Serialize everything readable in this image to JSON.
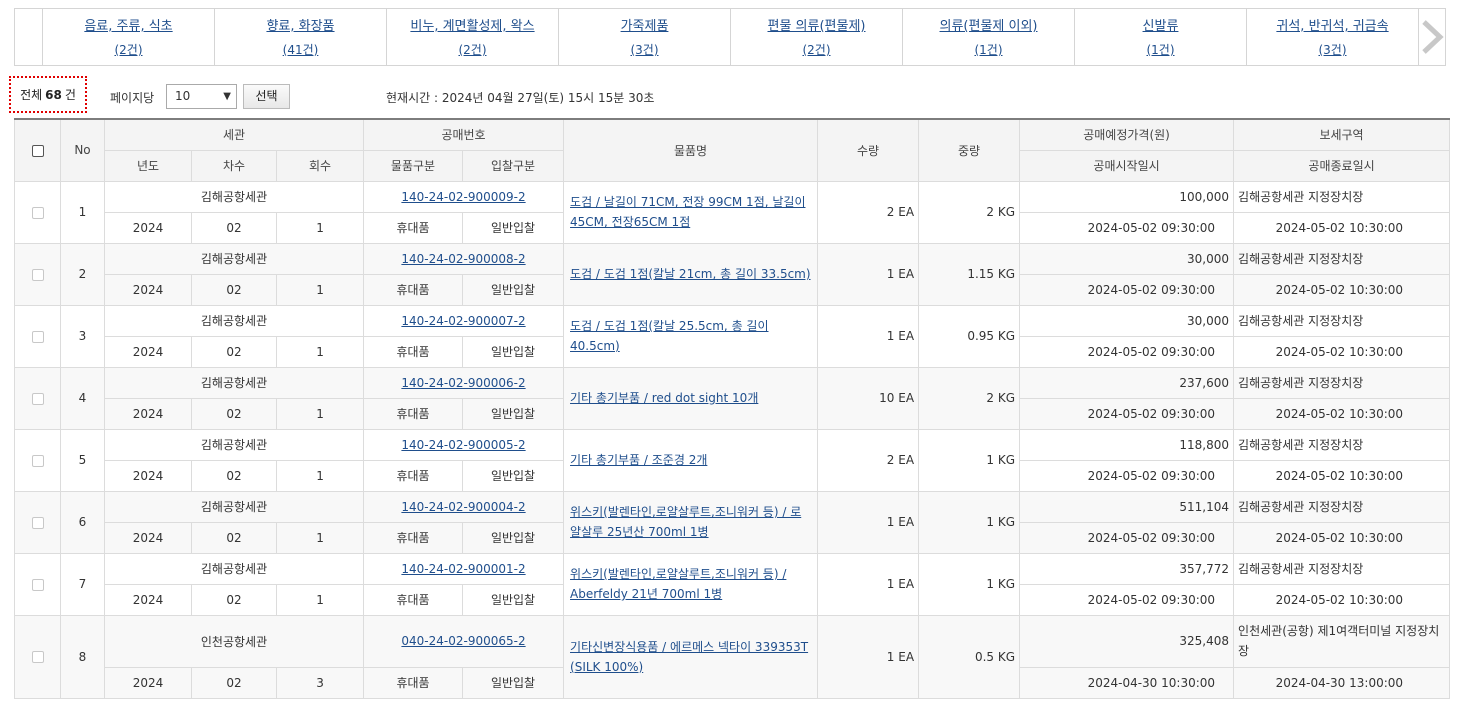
{
  "categories": [
    {
      "name": "음료, 주류, 식초",
      "count": "(2건)"
    },
    {
      "name": "향료, 화장품",
      "count": "(41건)"
    },
    {
      "name": "비누, 계면활성제, 왁스",
      "count": "(2건)"
    },
    {
      "name": "가죽제품",
      "count": "(3건)"
    },
    {
      "name": "편물 의류(편물제)",
      "count": "(2건)"
    },
    {
      "name": "의류(편물제 이외)",
      "count": "(1건)"
    },
    {
      "name": "신발류",
      "count": "(1건)"
    },
    {
      "name": "귀석, 반귀석, 귀금속",
      "count": "(3건)"
    }
  ],
  "icons": {
    "next": "chevron-right-icon",
    "dropdown": "triangle-down-icon"
  },
  "colors": {
    "link": "#1f4e8c",
    "highlight_border": "#e00000"
  },
  "toolbar": {
    "total_prefix": "전체",
    "total_count": "68",
    "total_suffix": "건",
    "per_page_label": "페이지당",
    "per_page_value": "10",
    "select_button": "선택",
    "current_time": "현재시간 : 2024년 04월 27일(토) 15시 15분 30초"
  },
  "table": {
    "headers": {
      "no": "No",
      "customs": "세관",
      "year": "년도",
      "session": "차수",
      "round": "회수",
      "auction_no": "공매번호",
      "item_type": "물품구분",
      "bid_type": "입찰구분",
      "item_name": "물품명",
      "quantity": "수량",
      "weight": "중량",
      "price": "공매예정가격(원)",
      "start_date": "공매시작일시",
      "bonded_area": "보세구역",
      "end_date": "공매종료일시"
    },
    "rows": [
      {
        "no": "1",
        "customs": "김해공항세관",
        "year": "2024",
        "session": "02",
        "round": "1",
        "auction_no": "140-24-02-900009-2",
        "item_type": "휴대품",
        "bid_type": "일반입찰",
        "item_name": "도검 / 날길이 71CM, 전장 99CM 1점, 날길이 45CM, 전장65CM 1점",
        "quantity": "2 EA",
        "weight": "2 KG",
        "price": "100,000",
        "start_date": "2024-05-02 09:30:00",
        "bonded_area": "김해공항세관 지정장치장",
        "end_date": "2024-05-02 10:30:00"
      },
      {
        "no": "2",
        "customs": "김해공항세관",
        "year": "2024",
        "session": "02",
        "round": "1",
        "auction_no": "140-24-02-900008-2",
        "item_type": "휴대품",
        "bid_type": "일반입찰",
        "item_name": "도검 / 도검 1점(칼날 21cm, 총 길이 33.5cm)",
        "quantity": "1 EA",
        "weight": "1.15 KG",
        "price": "30,000",
        "start_date": "2024-05-02 09:30:00",
        "bonded_area": "김해공항세관 지정장치장",
        "end_date": "2024-05-02 10:30:00"
      },
      {
        "no": "3",
        "customs": "김해공항세관",
        "year": "2024",
        "session": "02",
        "round": "1",
        "auction_no": "140-24-02-900007-2",
        "item_type": "휴대품",
        "bid_type": "일반입찰",
        "item_name": "도검 / 도검 1점(칼날 25.5cm, 총 길이 40.5cm)",
        "quantity": "1 EA",
        "weight": "0.95 KG",
        "price": "30,000",
        "start_date": "2024-05-02 09:30:00",
        "bonded_area": "김해공항세관 지정장치장",
        "end_date": "2024-05-02 10:30:00"
      },
      {
        "no": "4",
        "customs": "김해공항세관",
        "year": "2024",
        "session": "02",
        "round": "1",
        "auction_no": "140-24-02-900006-2",
        "item_type": "휴대품",
        "bid_type": "일반입찰",
        "item_name": "기타 총기부품 / red dot sight 10개",
        "quantity": "10 EA",
        "weight": "2 KG",
        "price": "237,600",
        "start_date": "2024-05-02 09:30:00",
        "bonded_area": "김해공항세관 지정장치장",
        "end_date": "2024-05-02 10:30:00"
      },
      {
        "no": "5",
        "customs": "김해공항세관",
        "year": "2024",
        "session": "02",
        "round": "1",
        "auction_no": "140-24-02-900005-2",
        "item_type": "휴대품",
        "bid_type": "일반입찰",
        "item_name": "기타 총기부품 / 조준경 2개",
        "quantity": "2 EA",
        "weight": "1 KG",
        "price": "118,800",
        "start_date": "2024-05-02 09:30:00",
        "bonded_area": "김해공항세관 지정장치장",
        "end_date": "2024-05-02 10:30:00"
      },
      {
        "no": "6",
        "customs": "김해공항세관",
        "year": "2024",
        "session": "02",
        "round": "1",
        "auction_no": "140-24-02-900004-2",
        "item_type": "휴대품",
        "bid_type": "일반입찰",
        "item_name": "위스키(발렌타인,로얄살루트,조니워커 등) / 로얄살루 25년산 700ml 1병",
        "quantity": "1 EA",
        "weight": "1 KG",
        "price": "511,104",
        "start_date": "2024-05-02 09:30:00",
        "bonded_area": "김해공항세관 지정장치장",
        "end_date": "2024-05-02 10:30:00"
      },
      {
        "no": "7",
        "customs": "김해공항세관",
        "year": "2024",
        "session": "02",
        "round": "1",
        "auction_no": "140-24-02-900001-2",
        "item_type": "휴대품",
        "bid_type": "일반입찰",
        "item_name": "위스키(발렌타인,로얄살루트,조니워커 등) / Aberfeldy 21년 700ml 1병",
        "quantity": "1 EA",
        "weight": "1 KG",
        "price": "357,772",
        "start_date": "2024-05-02 09:30:00",
        "bonded_area": "김해공항세관 지정장치장",
        "end_date": "2024-05-02 10:30:00"
      },
      {
        "no": "8",
        "customs": "인천공항세관",
        "year": "2024",
        "session": "02",
        "round": "3",
        "auction_no": "040-24-02-900065-2",
        "item_type": "휴대품",
        "bid_type": "일반입찰",
        "item_name": "기타신변장식용품 / 에르메스 넥타이 339353T (SILK 100%)",
        "quantity": "1 EA",
        "weight": "0.5 KG",
        "price": "325,408",
        "start_date": "2024-04-30 10:30:00",
        "bonded_area": "인천세관(공항) 제1여객터미널 지정장치장",
        "end_date": "2024-04-30 13:00:00"
      }
    ]
  }
}
